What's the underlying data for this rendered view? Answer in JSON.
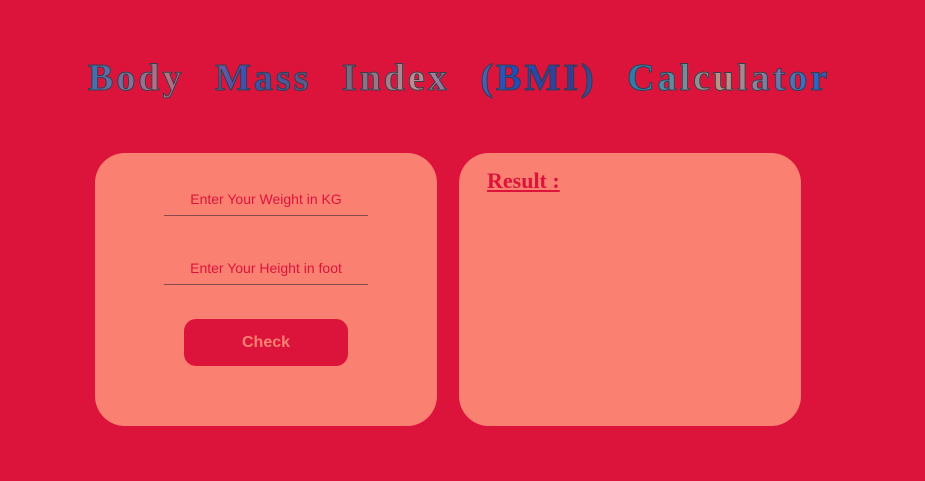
{
  "header": {
    "title": "Body Mass Index (BMI) Calculator"
  },
  "form": {
    "weight_placeholder": "Enter Your Weight in KG",
    "weight_value": "",
    "height_placeholder": "Enter Your Height in foot",
    "height_value": "",
    "check_label": "Check"
  },
  "result": {
    "label": "Result :",
    "value": ""
  },
  "colors": {
    "background": "#dc143c",
    "panel": "#fa8072",
    "accent": "#dc143c"
  }
}
